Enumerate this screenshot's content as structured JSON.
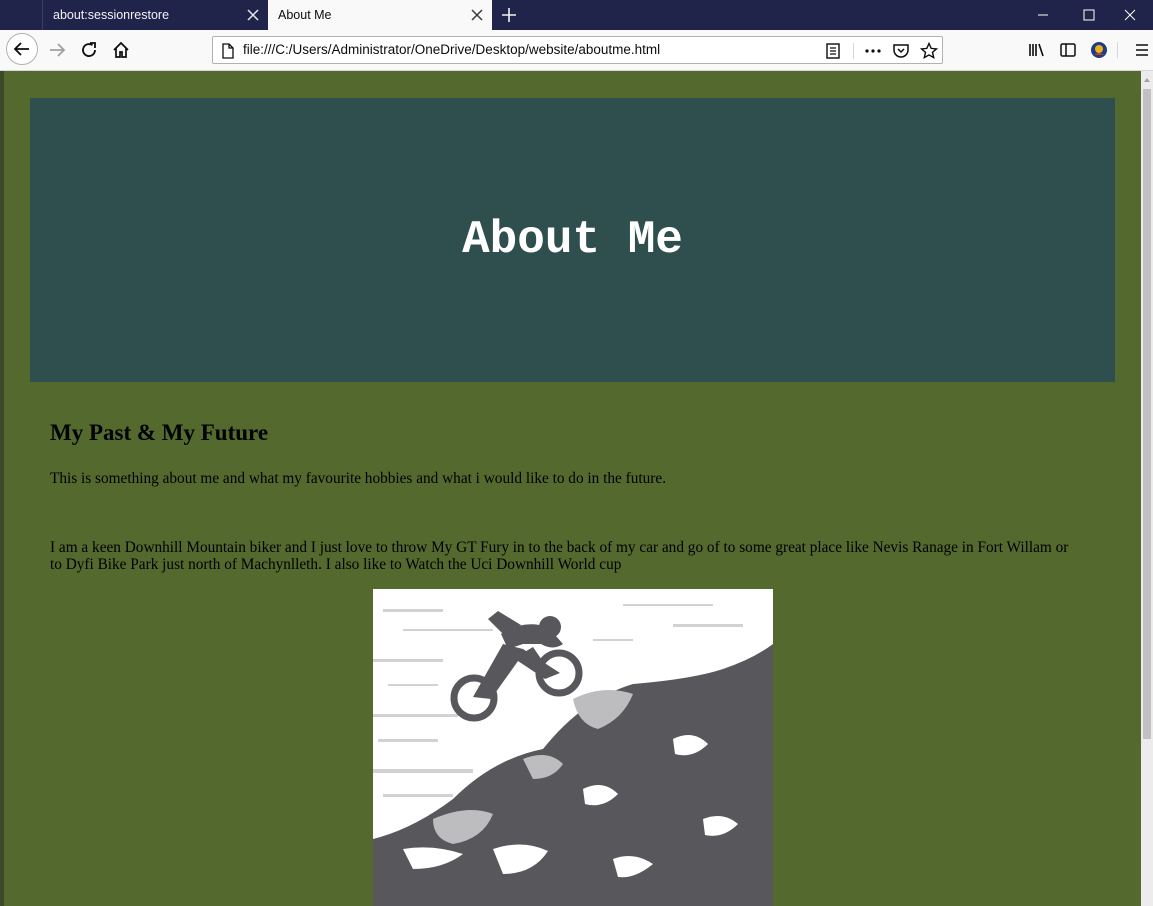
{
  "browser": {
    "tabs": [
      {
        "title": "about:sessionrestore",
        "active": false
      },
      {
        "title": "About Me",
        "active": true
      }
    ],
    "url": "file:///C:/Users/Administrator/OneDrive/Desktop/website/aboutme.html"
  },
  "page": {
    "hero_title": "About Me",
    "section_title": "My Past & My Future",
    "paragraph_1": "This is something about me and what my favourite hobbies and what i would like to do in the future.",
    "paragraph_2": "I am a keen Downhill Mountain biker and I just love to throw My GT Fury in to the back of my car and go of to some great place like Nevis Ranage in Fort Willam or to Dyfi Bike Park just north of Machynlleth. I also like to Watch the Uci Downhill World cup"
  },
  "colors": {
    "page_background": "#54692e",
    "hero_background": "#2f4f4f",
    "hero_text": "#ffffff",
    "tabbar": "#20244a",
    "photo_dark": "#58585c"
  },
  "icons": [
    "close-icon",
    "plus-icon",
    "minimize-icon",
    "maximize-icon",
    "back-icon",
    "forward-icon",
    "reload-icon",
    "home-icon",
    "file-icon",
    "reader-view-icon",
    "more-icon",
    "pocket-icon",
    "star-icon",
    "library-icon",
    "sidebar-icon",
    "account-icon",
    "menu-icon"
  ]
}
